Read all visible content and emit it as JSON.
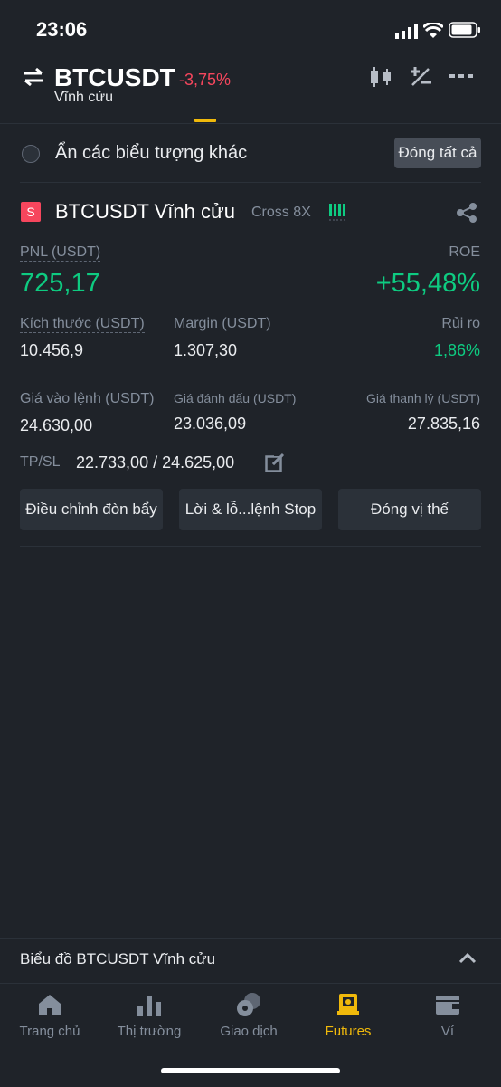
{
  "status_bar": {
    "time": "23:06"
  },
  "header": {
    "symbol": "BTCUSDT",
    "change": "-3,75%",
    "subtitle": "Vĩnh cửu",
    "icons": [
      "swap-icon",
      "candlestick-icon",
      "calculator-icon",
      "more-icon"
    ]
  },
  "filter": {
    "hide_symbols_label": "Ẩn các biểu tượng khác",
    "close_all_label": "Đóng tất cả"
  },
  "position": {
    "side_badge": "S",
    "title": "BTCUSDT Vĩnh cửu",
    "margin_mode": "Cross 8X",
    "pnl_label": "PNL (USDT)",
    "pnl_value": "725,17",
    "roe_label": "ROE",
    "roe_value": "+55,48%",
    "size_label": "Kích thước (USDT)",
    "size_value": "10.456,9",
    "margin_label": "Margin (USDT)",
    "margin_value": "1.307,30",
    "risk_label": "Rủi ro",
    "risk_value": "1,86%",
    "entry_label": "Giá vào lệnh (USDT)",
    "entry_value": "24.630,00",
    "mark_label": "Giá đánh dấu (USDT)",
    "mark_value": "23.036,09",
    "liq_label": "Giá thanh lý (USDT)",
    "liq_value": "27.835,16",
    "tpsl_label": "TP/SL",
    "tpsl_value": "22.733,00 / 24.625,00",
    "buttons": {
      "leverage": "Điều chỉnh đòn bẩy",
      "stop": "Lời & lỗ...lệnh Stop",
      "close": "Đóng vị thế"
    }
  },
  "chart_bar": {
    "label": "Biểu đồ BTCUSDT Vĩnh cửu"
  },
  "nav": {
    "items": [
      {
        "label": "Trang chủ"
      },
      {
        "label": "Thị trường"
      },
      {
        "label": "Giao dịch"
      },
      {
        "label": "Futures"
      },
      {
        "label": "Ví"
      }
    ],
    "active_index": 3
  },
  "colors": {
    "accent": "#f0b90b",
    "positive": "#0ecb81",
    "negative": "#f6465d"
  }
}
